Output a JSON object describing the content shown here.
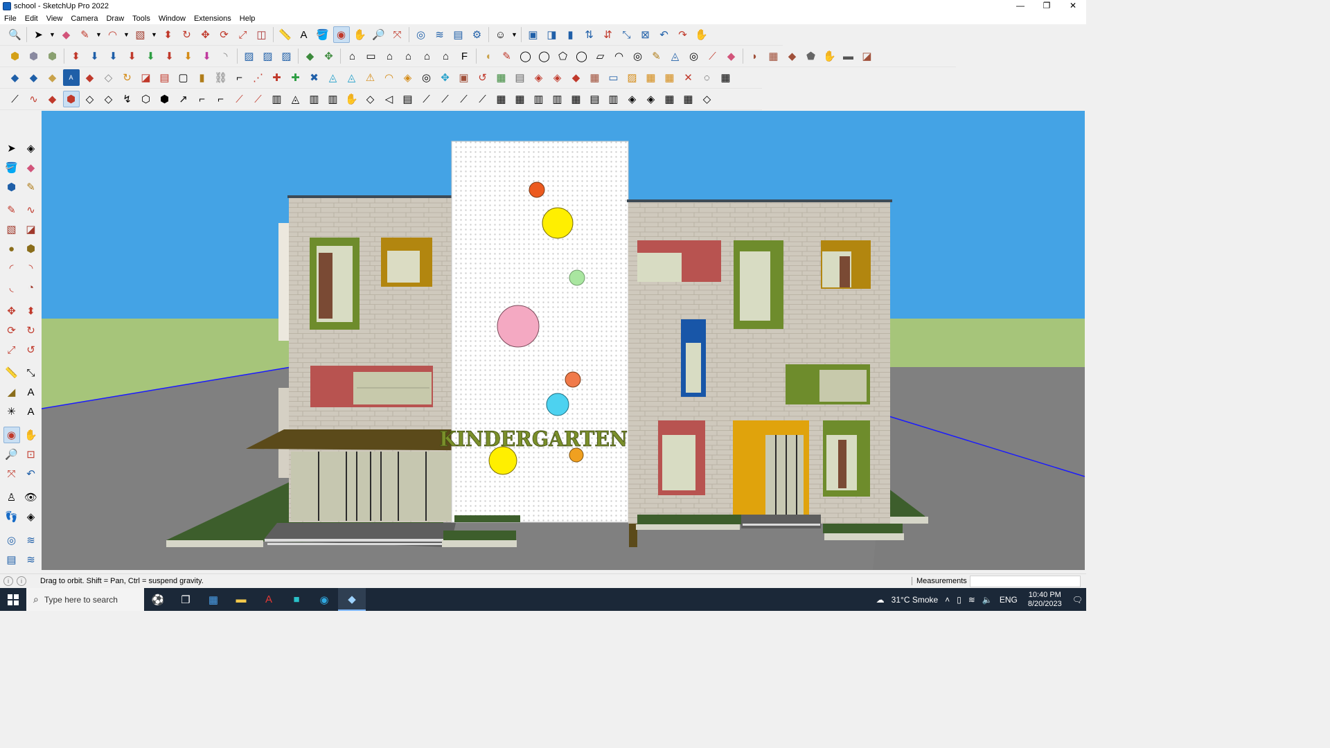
{
  "window": {
    "title": "school - SketchUp Pro 2022",
    "controls": [
      "—",
      "❐",
      "✕"
    ]
  },
  "menu": [
    "File",
    "Edit",
    "View",
    "Camera",
    "Draw",
    "Tools",
    "Window",
    "Extensions",
    "Help"
  ],
  "model": {
    "sign_text": "KINDERGARTEN"
  },
  "status": {
    "hint": "Drag to orbit. Shift = Pan, Ctrl = suspend gravity.",
    "measurements_label": "Measurements",
    "measurements_value": ""
  },
  "taskbar": {
    "search_placeholder": "Type here to search",
    "weather": "31°C  Smoke",
    "language": "ENG",
    "time": "10:40 PM",
    "date": "8/20/2023"
  },
  "colors": {
    "sky": "#44a3e5",
    "grass": "#a6c57a",
    "road": "#808080",
    "brick": "#cfc9bd",
    "olive_frame": "#6e8c2c",
    "mustard_frame": "#b2860f",
    "red_frame": "#b85350",
    "sign": "#7a8f2a"
  }
}
